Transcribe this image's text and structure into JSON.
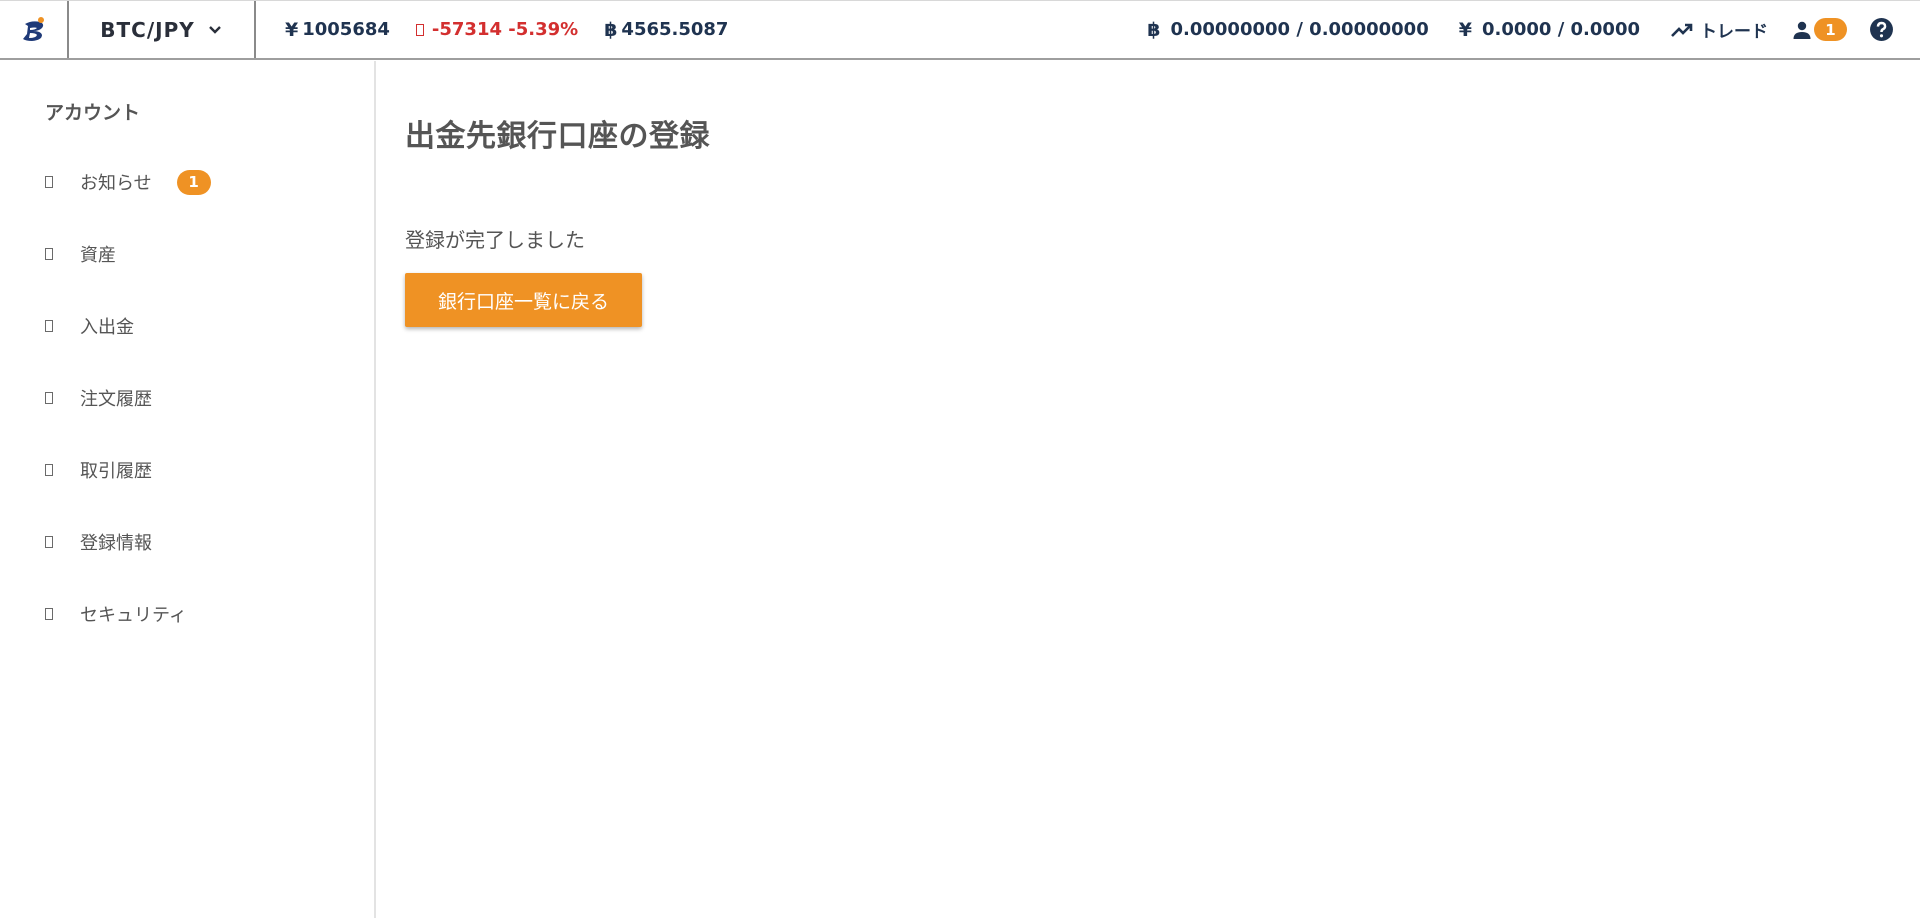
{
  "header": {
    "logo": "bitpoint-logo-icon",
    "pair": "BTC/JPY",
    "ticker": {
      "price_symbol": "¥",
      "price": "1005684",
      "change": "-57314 -5.39%",
      "btc_symbol": "฿",
      "btc_value": "4565.5087"
    },
    "balances": {
      "btc_symbol": "฿",
      "btc": "0.00000000 / 0.00000000",
      "jpy_symbol": "¥",
      "jpy": "0.0000 / 0.0000"
    },
    "trade_label": "トレード",
    "user_badge": "1"
  },
  "sidebar": {
    "heading": "アカウント",
    "items": [
      {
        "label": "お知らせ",
        "badge": "1"
      },
      {
        "label": "資産"
      },
      {
        "label": "入出金"
      },
      {
        "label": "注文履歴"
      },
      {
        "label": "取引履歴"
      },
      {
        "label": "登録情報"
      },
      {
        "label": "セキュリティ"
      }
    ]
  },
  "main": {
    "title": "出金先銀行口座の登録",
    "message": "登録が完了しました",
    "back_button": "銀行口座一覧に戻る"
  },
  "colors": {
    "accent": "#ef9224",
    "navy": "#1f3350",
    "down": "#d32f2f",
    "text": "#555555"
  }
}
